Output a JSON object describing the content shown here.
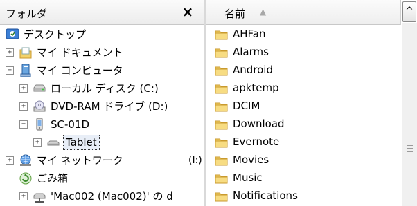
{
  "folder_pane": {
    "title": "フォルダ",
    "close_glyph": "×",
    "tree": [
      {
        "label": "デスクトップ",
        "icon": "desktop-icon",
        "expander": ""
      },
      {
        "label": "マイ ドキュメント",
        "icon": "my-documents-icon",
        "expander": "+"
      },
      {
        "label": "マイ コンピュータ",
        "icon": "my-computer-icon",
        "expander": "−"
      },
      {
        "label": "ローカル ディスク (C:)",
        "icon": "local-disk-icon",
        "expander": "+"
      },
      {
        "label": "DVD-RAM ドライブ (D:)",
        "icon": "dvd-drive-icon",
        "expander": "+"
      },
      {
        "label": "SC-01D",
        "icon": "portable-device-icon",
        "expander": "−"
      },
      {
        "label": "Tablet",
        "icon": "device-storage-icon",
        "expander": "+"
      },
      {
        "label": "マイ ネットワーク",
        "icon": "network-icon",
        "expander": "+"
      },
      {
        "label": "ごみ箱",
        "icon": "recycle-bin-icon",
        "expander": ""
      },
      {
        "label": "'Mac002 (Mac002)' の d",
        "icon": "network-drive-icon",
        "expander": "+"
      }
    ],
    "stray_label": "(I:)"
  },
  "file_pane": {
    "column_name": "名前",
    "sort_glyph": "▲",
    "scroll_up_glyph": "^",
    "files": [
      {
        "name": "AHFan"
      },
      {
        "name": "Alarms"
      },
      {
        "name": "Android"
      },
      {
        "name": "apktemp"
      },
      {
        "name": "DCIM"
      },
      {
        "name": "Download"
      },
      {
        "name": "Evernote"
      },
      {
        "name": "Movies"
      },
      {
        "name": "Music"
      },
      {
        "name": "Notifications"
      }
    ]
  },
  "colors": {
    "folder_yellow": "#f3d36b",
    "folder_edge": "#c99a2e",
    "selection_bg": "#e8eef7"
  }
}
